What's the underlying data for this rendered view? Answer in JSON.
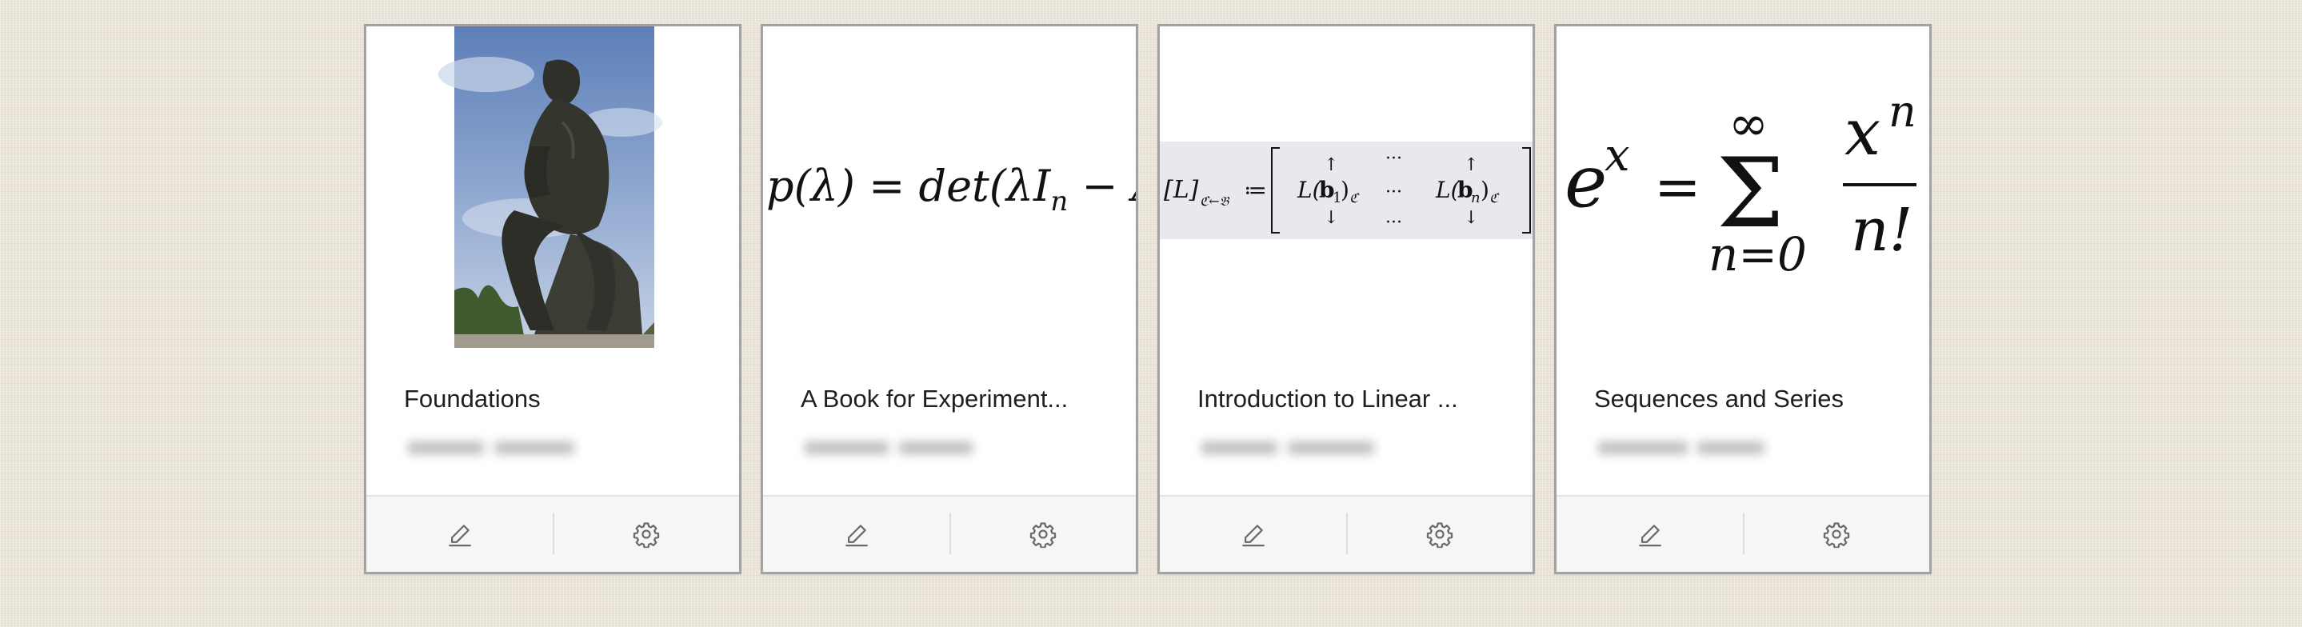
{
  "books": [
    {
      "title": "Foundations",
      "cover": {
        "kind": "image",
        "subject": "bronze seated thinker statue against a cloudy blue sky"
      },
      "actions": {
        "edit_icon": "pencil-icon",
        "settings_icon": "gear-icon"
      }
    },
    {
      "title": "A Book for Experiment...",
      "cover": {
        "kind": "formula",
        "text": "p(λ) = det(λIn − A)"
      },
      "actions": {
        "edit_icon": "pencil-icon",
        "settings_icon": "gear-icon"
      }
    },
    {
      "title": "Introduction to Linear ...",
      "cover": {
        "kind": "formula",
        "text": "[L]C←B := [ L(b1)C ··· L(bn)C ]"
      },
      "actions": {
        "edit_icon": "pencil-icon",
        "settings_icon": "gear-icon"
      }
    },
    {
      "title": "Sequences and Series",
      "cover": {
        "kind": "formula",
        "text": "e^x = Σ n=0..∞ x^n / n!"
      },
      "actions": {
        "edit_icon": "pencil-icon",
        "settings_icon": "gear-icon"
      }
    }
  ],
  "colors": {
    "page_background": "#efe9dc",
    "card_border": "#a3a3a3",
    "footer_background": "#f6f6f6",
    "icon": "#6b6b6b"
  }
}
